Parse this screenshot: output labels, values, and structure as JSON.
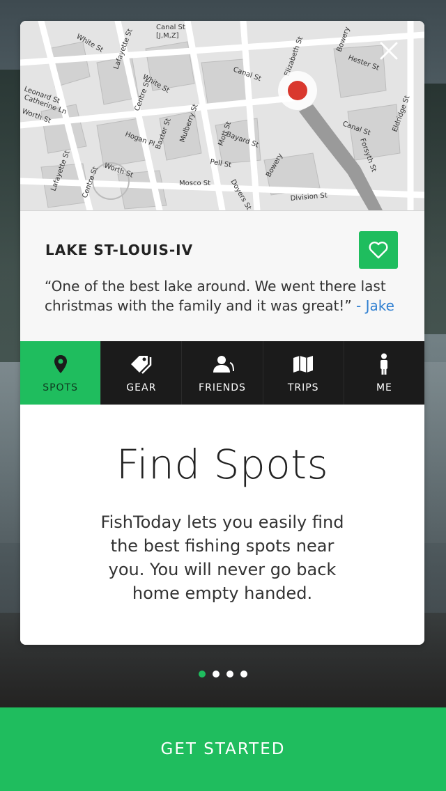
{
  "map": {
    "streets": [
      "White St",
      "Lafayette St",
      "Canal St",
      "[J,M,Z]",
      "Leonard St",
      "Catherine Ln",
      "Worth St",
      "Centre St",
      "White St",
      "Baxter St",
      "Hogan Pl",
      "Canal St",
      "Elizabeth St",
      "Hester St",
      "Bowery",
      "Mulberry St",
      "Mott St",
      "Bayard St",
      "Pell St",
      "Doyers St",
      "Mosco St",
      "Bowery",
      "Division St",
      "Canal St",
      "Forsyth St",
      "Eldridge St",
      "Lafayette St",
      "Centre St",
      "Worth St"
    ]
  },
  "spot": {
    "title": "LAKE ST-LOUIS-IV",
    "quote": "“One of the best lake around. We went there last christmas with the family and it was great!”",
    "author": "- Jake"
  },
  "tabs": [
    {
      "label": "SPOTS",
      "icon": "map-pin-icon",
      "active": true
    },
    {
      "label": "GEAR",
      "icon": "tags-icon",
      "active": false
    },
    {
      "label": "FRIENDS",
      "icon": "users-icon",
      "active": false
    },
    {
      "label": "TRIPS",
      "icon": "map-icon",
      "active": false
    },
    {
      "label": "ME",
      "icon": "person-icon",
      "active": false
    }
  ],
  "content": {
    "title": "Find Spots",
    "description": "FishToday lets you easily find the best fishing spots near you. You will never go back home empty handed."
  },
  "pagination": {
    "total": 4,
    "current": 1
  },
  "cta": {
    "label": "GET STARTED"
  },
  "colors": {
    "accent": "#1fbd5e",
    "pin": "#d9382e",
    "tabbar": "#1b1b1b",
    "link": "#2f7fd1"
  }
}
